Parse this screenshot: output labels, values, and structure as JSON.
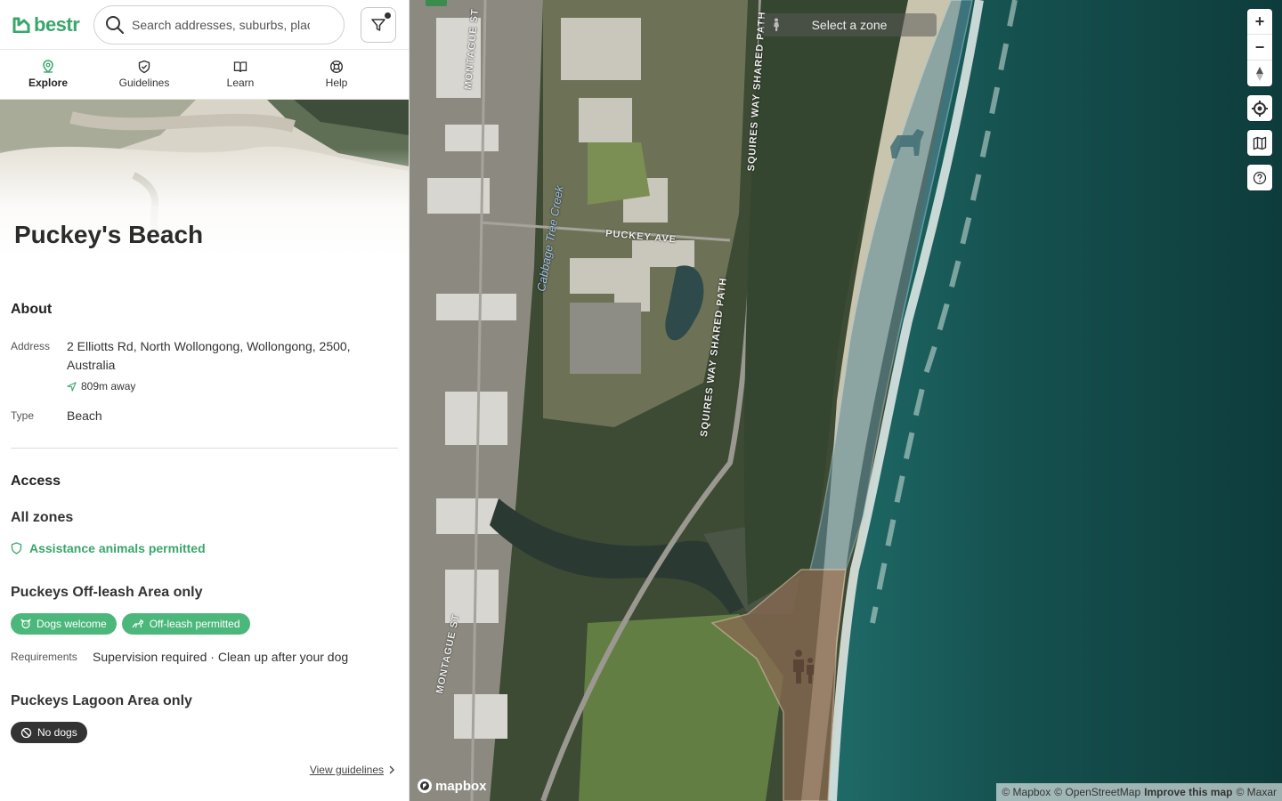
{
  "app": {
    "logo_text": "bestr",
    "brand_color": "#3aa66b"
  },
  "search": {
    "placeholder": "Search addresses, suburbs, places"
  },
  "tabs": [
    {
      "label": "Explore",
      "icon": "map-pin-icon",
      "active": true
    },
    {
      "label": "Guidelines",
      "icon": "shield-check-icon",
      "active": false
    },
    {
      "label": "Learn",
      "icon": "book-icon",
      "active": false
    },
    {
      "label": "Help",
      "icon": "lifebuoy-icon",
      "active": false
    }
  ],
  "place": {
    "title": "Puckey's Beach",
    "about_heading": "About",
    "address_label": "Address",
    "address": "2 Elliotts Rd, North Wollongong, Wollongong, 2500, Australia",
    "distance": "809m away",
    "type_label": "Type",
    "type": "Beach"
  },
  "access": {
    "heading": "Access",
    "zones": [
      {
        "title": "All zones",
        "note": "Assistance animals permitted"
      },
      {
        "title": "Puckeys Off-leash Area only",
        "badges": [
          "Dogs welcome",
          "Off-leash permitted"
        ],
        "requirements_label": "Requirements",
        "requirements": "Supervision required · Clean up after your dog"
      },
      {
        "title": "Puckeys Lagoon Area only",
        "badges": [
          "No dogs"
        ]
      }
    ],
    "view_guidelines": "View guidelines"
  },
  "map": {
    "zone_selector": "Select a zone",
    "labels": {
      "montague_top": "MONTAGUE ST",
      "montague_bottom": "MONTAGUE ST",
      "puckey_ave": "PUCKEY AVE",
      "squires_top": "SQUIRES WAY SHARED PATH",
      "squires_mid": "SQUIRES WAY SHARED PATH",
      "creek": "Cabbage Tree Creek"
    },
    "controls": {
      "zoom_in": "+",
      "zoom_out": "−"
    },
    "logo_text": "mapbox",
    "attribution": {
      "mapbox": "© Mapbox",
      "osm": "© OpenStreetMap",
      "improve": "Improve this map",
      "maxar": "© Maxar"
    }
  }
}
